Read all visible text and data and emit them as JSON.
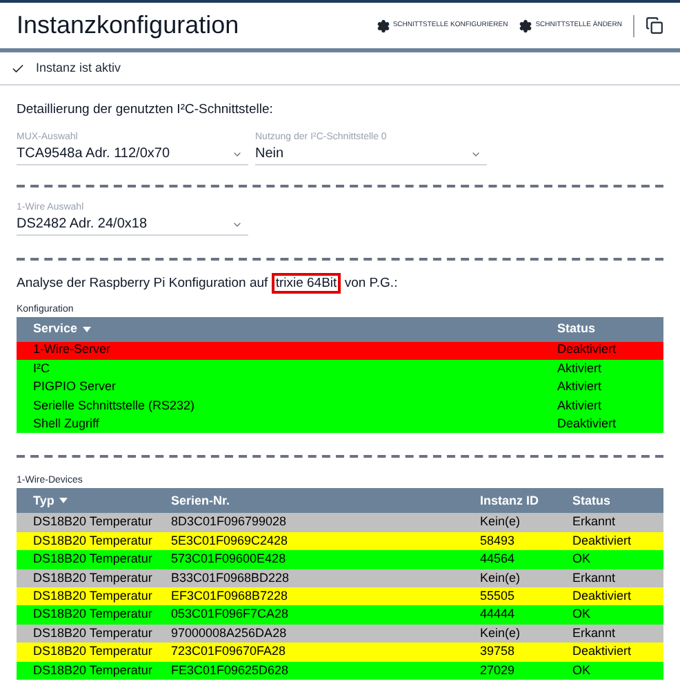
{
  "header": {
    "title": "Instanzkonfiguration",
    "actions": [
      {
        "label": "SCHNITTSTELLE KONFIGURIEREN"
      },
      {
        "label": "SCHNITTSTELLE ÄNDERN"
      }
    ]
  },
  "status": {
    "label": "Instanz ist aktiv",
    "checked": true
  },
  "i2c": {
    "heading": "Detaillierung der genutzten I²C-Schnittstelle:",
    "fields": [
      {
        "label": "MUX-Auswahl",
        "value": "TCA9548a Adr. 112/0x70"
      },
      {
        "label": "Nutzung der I²C-Schnittstelle 0",
        "value": "Nein"
      }
    ]
  },
  "onewire": {
    "fields": [
      {
        "label": "1-Wire Auswahl",
        "value": "DS2482 Adr. 24/0x18"
      }
    ]
  },
  "analysis": {
    "before": "Analyse der Raspberry Pi Konfiguration auf ",
    "highlighted": "trixie 64Bit",
    "after": " von P.G.:"
  },
  "config_table": {
    "caption": "Konfiguration",
    "columns": [
      "Service",
      "Status"
    ],
    "rows": [
      {
        "cells": [
          "1-Wire-Server",
          "Deaktiviert"
        ],
        "color": "#ff0000"
      },
      {
        "cells": [
          "I²C",
          "Aktiviert"
        ],
        "color": "#00ff00"
      },
      {
        "cells": [
          "PIGPIO Server",
          "Aktiviert"
        ],
        "color": "#00ff00"
      },
      {
        "cells": [
          "Serielle Schnittstelle (RS232)",
          "Aktiviert"
        ],
        "color": "#00ff00"
      },
      {
        "cells": [
          "Shell Zugriff",
          "Deaktiviert"
        ],
        "color": "#00ff00"
      }
    ]
  },
  "devices_table": {
    "caption": "1-Wire-Devices",
    "columns": [
      "Typ",
      "Serien-Nr.",
      "Instanz ID",
      "Status"
    ],
    "rows": [
      {
        "cells": [
          "DS18B20 Temperatur",
          "8D3C01F096799028",
          "Kein(e)",
          "Erkannt"
        ],
        "color": "#c0c0c0"
      },
      {
        "cells": [
          "DS18B20 Temperatur",
          "5E3C01F0969C2428",
          "58493",
          "Deaktiviert"
        ],
        "color": "#ffff00"
      },
      {
        "cells": [
          "DS18B20 Temperatur",
          "573C01F09600E428",
          "44564",
          "OK"
        ],
        "color": "#00ff00"
      },
      {
        "cells": [
          "DS18B20 Temperatur",
          "B33C01F0968BD228",
          "Kein(e)",
          "Erkannt"
        ],
        "color": "#c0c0c0"
      },
      {
        "cells": [
          "DS18B20 Temperatur",
          "EF3C01F0968B7228",
          "55505",
          "Deaktiviert"
        ],
        "color": "#ffff00"
      },
      {
        "cells": [
          "DS18B20 Temperatur",
          "053C01F096F7CA28",
          "44444",
          "OK"
        ],
        "color": "#00ff00"
      },
      {
        "cells": [
          "DS18B20 Temperatur",
          "97000008A256DA28",
          "Kein(e)",
          "Erkannt"
        ],
        "color": "#c0c0c0"
      },
      {
        "cells": [
          "DS18B20 Temperatur",
          "723C01F09670FA28",
          "39758",
          "Deaktiviert"
        ],
        "color": "#ffff00"
      },
      {
        "cells": [
          "DS18B20 Temperatur",
          "FE3C01F09625D628",
          "27029",
          "OK"
        ],
        "color": "#00ff00"
      }
    ]
  }
}
